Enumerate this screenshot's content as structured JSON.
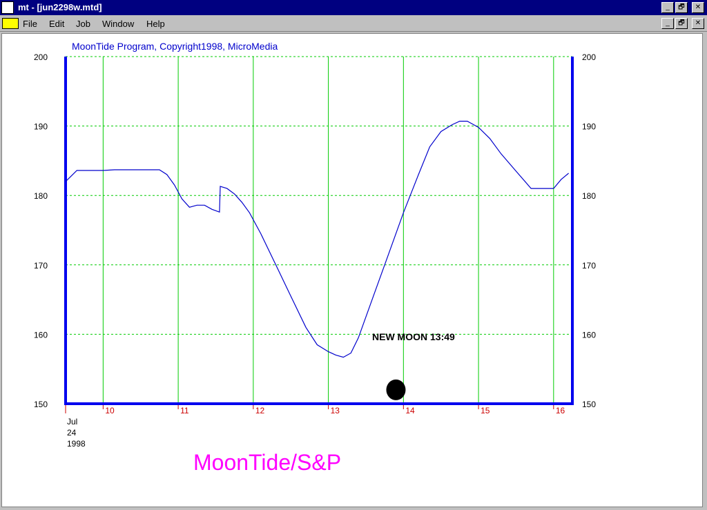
{
  "window": {
    "title": "mt - [jun2298w.mtd]",
    "controls": {
      "minimize": "_",
      "restore": "🗗",
      "close": "✕"
    }
  },
  "menu": {
    "items": [
      {
        "label": "File"
      },
      {
        "label": "Edit"
      },
      {
        "label": "Job"
      },
      {
        "label": "Window"
      },
      {
        "label": "Help"
      }
    ]
  },
  "chart": {
    "copyright": "MoonTide Program, Copyright1998, MicroMedia",
    "watermark": "MoonTide/S&P",
    "annotation": "NEW MOON 13:49",
    "date_label": [
      "Jul",
      "24",
      "1998"
    ],
    "colors": {
      "line": "#0000cc",
      "frame": "#0000ee",
      "grid": "#00cc00",
      "tick_label_x": "#cc0000",
      "watermark": "#ff00ff",
      "copyright": "#0000cc"
    }
  },
  "chart_data": {
    "type": "line",
    "ylim": [
      150,
      200
    ],
    "xlim": [
      9.5,
      16.25
    ],
    "y_ticks": [
      150,
      160,
      170,
      180,
      190,
      200
    ],
    "x_ticks": [
      10,
      11,
      12,
      13,
      14,
      15,
      16
    ],
    "grid": true,
    "series": [
      {
        "x": [
          9.5,
          9.65,
          10.0,
          10.15,
          10.5,
          10.75,
          10.85,
          10.95,
          11.05,
          11.15,
          11.25,
          11.35,
          11.45,
          11.55,
          11.56,
          11.65,
          11.75,
          11.85,
          11.95,
          12.1,
          12.3,
          12.5,
          12.7,
          12.85,
          13.0,
          13.1,
          13.2,
          13.3,
          13.4,
          13.6,
          13.8,
          14.0,
          14.2,
          14.35,
          14.5,
          14.65,
          14.75,
          14.85,
          15.0,
          15.15,
          15.3,
          15.5,
          15.7,
          15.85,
          16.0,
          16.1,
          16.2
        ],
        "y": [
          182.0,
          183.6,
          183.6,
          183.7,
          183.7,
          183.7,
          183.0,
          181.5,
          179.5,
          178.3,
          178.6,
          178.6,
          178.0,
          177.6,
          181.3,
          181.0,
          180.2,
          179.0,
          177.5,
          174.5,
          170.0,
          165.5,
          161.0,
          158.5,
          157.5,
          157.0,
          156.7,
          157.3,
          159.5,
          165.5,
          171.5,
          177.5,
          183.0,
          187.0,
          189.2,
          190.2,
          190.7,
          190.7,
          189.8,
          188.2,
          186.0,
          183.5,
          181.0,
          181.0,
          181.0,
          182.3,
          183.2
        ]
      }
    ],
    "markers": [
      {
        "type": "new-moon",
        "x": 13.9,
        "y": 152
      }
    ]
  }
}
